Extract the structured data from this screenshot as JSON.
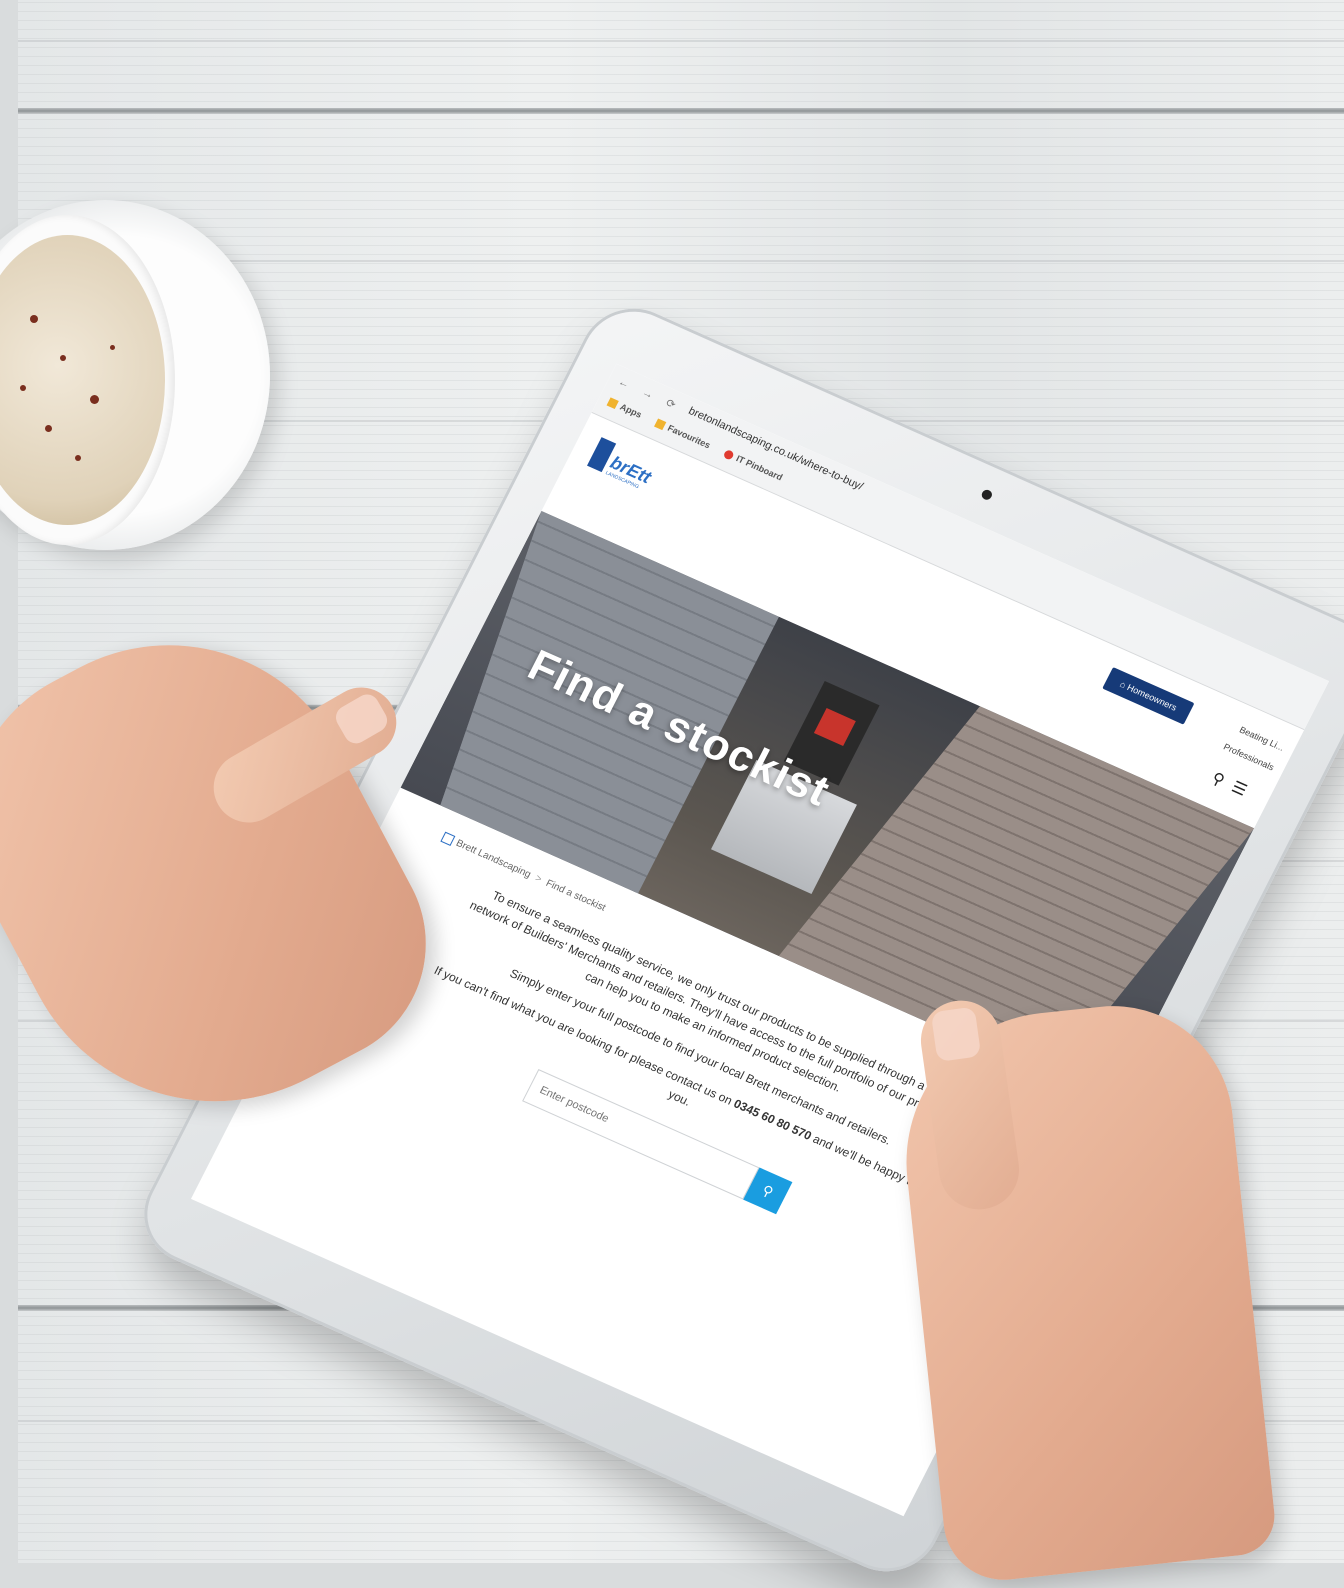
{
  "browser": {
    "nav_icons": "← → ⟳",
    "url": "bretonlandscaping.co.uk/where-to-buy/",
    "bookmarks": [
      {
        "label": "Apps"
      },
      {
        "label": "Favourites"
      },
      {
        "label": "IT Pinboard"
      }
    ]
  },
  "site": {
    "logo_word": "brEtt",
    "logo_tag": "LANDSCAPING",
    "homeowners_label": "Homeowners",
    "util_links": [
      "Beating Li...",
      "Professionals"
    ],
    "hero_title": "Find a stockist",
    "breadcrumb": {
      "home": "Brett Landscaping",
      "separator": ">",
      "current": "Find a stockist"
    },
    "intro_1": "To ensure a seamless quality service, we only trust our products to be supplied through a national network of Builders' Merchants and retailers. They'll have access to the full portfolio of our products and can help you to make an informed product selection.",
    "intro_2": "Simply enter your full postcode to find your local Brett merchants and retailers.",
    "intro_3_pre": "If you can't find what you are looking for please contact us on",
    "phone": "0345 60 80 570",
    "intro_3_post": "and we'll be happy to help you.",
    "postcode_placeholder": "Enter postcode"
  },
  "colors": {
    "primary_navy": "#163a78",
    "search_button": "#1a9de0",
    "logo_blue": "#2c6fc4"
  },
  "icons": [
    "search-icon",
    "menu-icon",
    "home-icon",
    "star-icon",
    "user-icon"
  ]
}
